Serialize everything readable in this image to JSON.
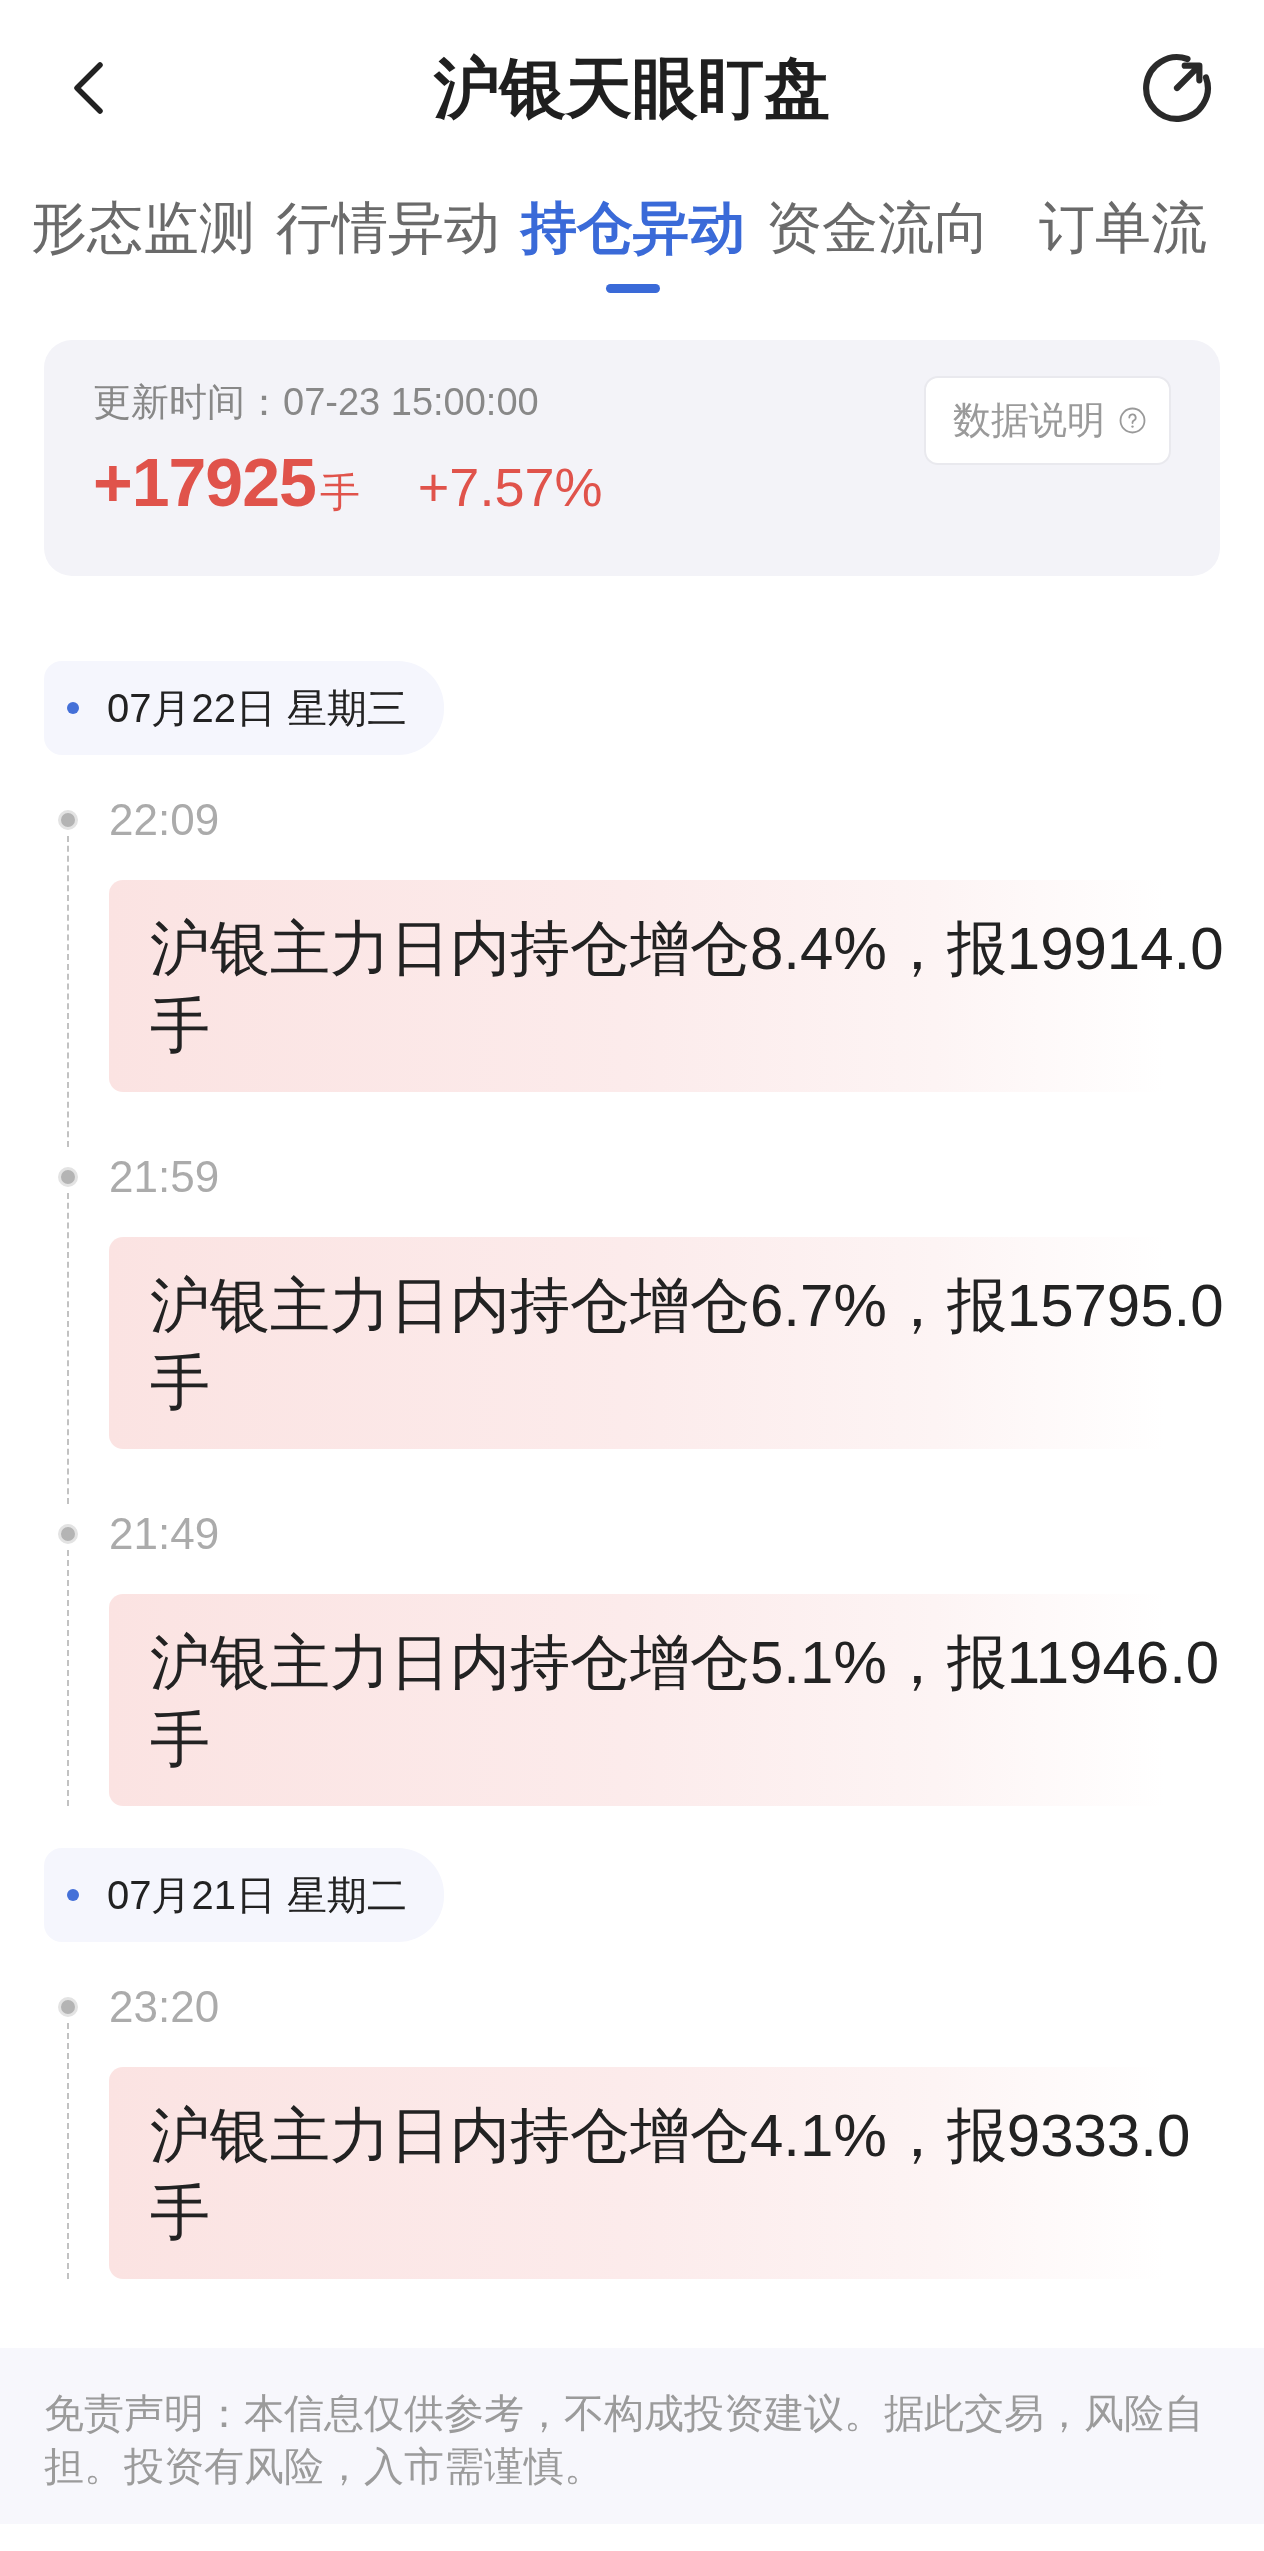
{
  "header": {
    "title": "沪银天眼盯盘"
  },
  "tabs": [
    {
      "label": "形态监测",
      "selected": false
    },
    {
      "label": "行情异动",
      "selected": false
    },
    {
      "label": "持仓异动",
      "selected": true
    },
    {
      "label": "资金流向",
      "selected": false
    },
    {
      "label": "订单流",
      "selected": false
    }
  ],
  "summary": {
    "updated": "更新时间：07-23 15:00:00",
    "position_change": "+17925",
    "unit": "手",
    "percent_change": "+7.57%",
    "info_button": "数据说明"
  },
  "timeline": [
    {
      "date": "07月22日 星期三",
      "events": [
        {
          "time": "22:09",
          "text": "沪银主力日内持仓增仓8.4%，报19914.0手"
        },
        {
          "time": "21:59",
          "text": "沪银主力日内持仓增仓6.7%，报15795.0手"
        },
        {
          "time": "21:49",
          "text": "沪银主力日内持仓增仓5.1%，报11946.0手"
        }
      ]
    },
    {
      "date": "07月21日 星期二",
      "events": [
        {
          "time": "23:20",
          "text": "沪银主力日内持仓增仓4.1%，报9333.0手"
        }
      ]
    }
  ],
  "disclaimer": "免责声明：本信息仅供参考，不构成投资建议。据此交易，风险自担。投资有风险，入市需谨慎。"
}
